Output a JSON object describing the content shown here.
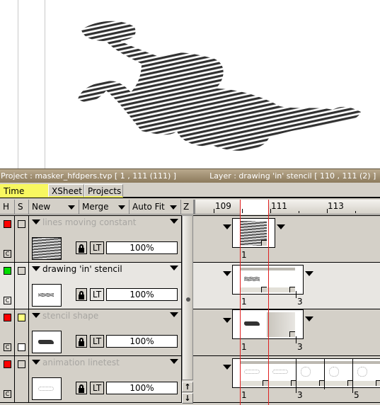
{
  "statusbar": {
    "project": "Project : masker_hfdpers.tvp [ 1 , 111  (111) ]",
    "layer": "Layer : drawing 'in' stencil [ 110 , 111  (2) ]"
  },
  "tabs": [
    {
      "label": "Time Line",
      "active": true
    },
    {
      "label": "XSheet",
      "active": false
    },
    {
      "label": "Projects",
      "active": false
    }
  ],
  "header": {
    "h": "H",
    "s": "S",
    "new": "New",
    "merge": "Merge",
    "autofit": "Auto Fit",
    "z": "Z"
  },
  "ruler": {
    "labels": [
      "109",
      "111",
      "113"
    ]
  },
  "layers": [
    {
      "name": "lines moving constant",
      "visible_color": "#ff0000",
      "solo_color": "",
      "opacity": "100%",
      "lt": "LT",
      "c": "C",
      "active": false,
      "frame_labels": [
        "1"
      ]
    },
    {
      "name": "drawing 'in' stencil",
      "visible_color": "#00dd00",
      "solo_color": "",
      "opacity": "100%",
      "lt": "LT",
      "c": "C",
      "active": true,
      "frame_labels": [
        "1",
        "3"
      ]
    },
    {
      "name": "stencil shape",
      "visible_color": "#ff0000",
      "solo_color": "#ffff80",
      "opacity": "100%",
      "lt": "LT",
      "c": "C",
      "active": false,
      "frame_labels": [
        "1",
        "3"
      ]
    },
    {
      "name": "animation linetest",
      "visible_color": "#ff0000",
      "solo_color": "",
      "opacity": "100%",
      "lt": "LT",
      "c": "C",
      "active": false,
      "frame_labels": [
        "1",
        "3",
        "5"
      ]
    }
  ],
  "zscroll": {
    "up": "↑",
    "down": "↓"
  }
}
